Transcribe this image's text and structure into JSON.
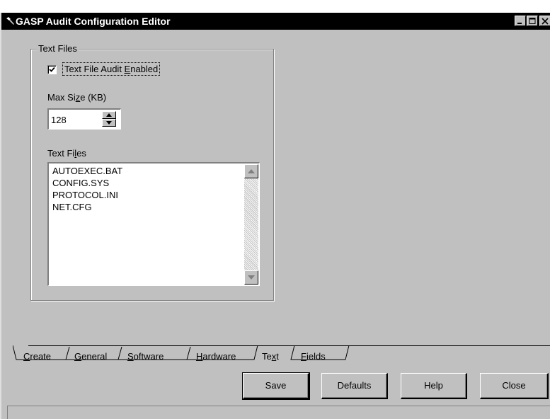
{
  "window": {
    "title": "GASP Audit Configuration Editor",
    "controls": [
      "minimize-icon",
      "maximize-icon",
      "close-icon"
    ]
  },
  "text_files_group": {
    "title": "Text Files",
    "audit_checkbox": {
      "label_pre": "Text File Audit ",
      "label_underlined": "E",
      "label_post": "nabled",
      "checked": true
    },
    "max_size": {
      "label_pre": "Max Si",
      "label_underlined": "z",
      "label_post": "e (KB)",
      "value": "128"
    },
    "files_label": {
      "pre": "Text Fi",
      "underlined": "l",
      "post": "es"
    },
    "files": [
      "AUTOEXEC.BAT",
      "CONFIG.SYS",
      "PROTOCOL.INI",
      "NET.CFG"
    ]
  },
  "tabs": [
    {
      "pre": "",
      "u": "C",
      "post": "reate",
      "selected": false
    },
    {
      "pre": "",
      "u": "G",
      "post": "eneral",
      "selected": false
    },
    {
      "pre": "",
      "u": "S",
      "post": "oftware",
      "selected": false
    },
    {
      "pre": "",
      "u": "H",
      "post": "ardware",
      "selected": false
    },
    {
      "pre": "Te",
      "u": "x",
      "post": "t",
      "selected": true
    },
    {
      "pre": "",
      "u": "F",
      "post": "ields",
      "selected": false
    }
  ],
  "buttons": {
    "save": "Save",
    "defaults": "Defaults",
    "help": "Help",
    "close": "Close"
  },
  "colors": {
    "face": "#c0c0c0",
    "titlebar": "#000000"
  }
}
